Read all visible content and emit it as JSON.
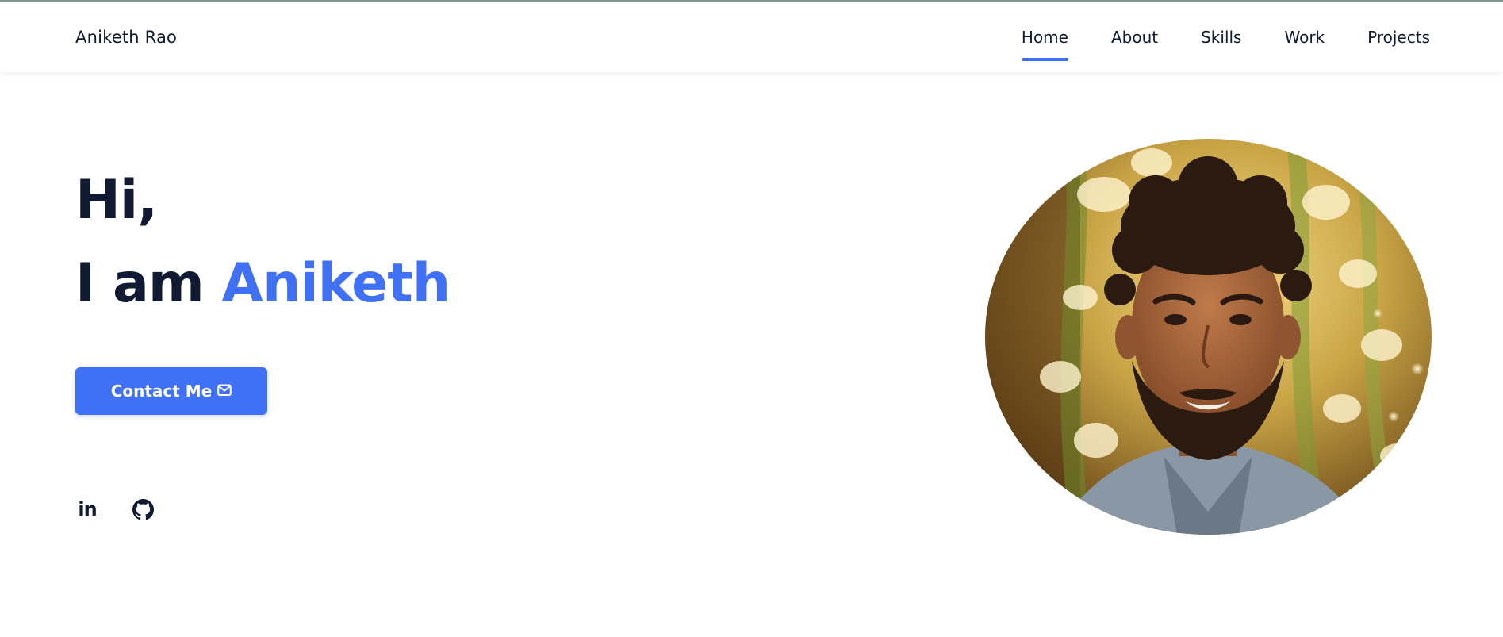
{
  "header": {
    "brand": "Aniketh Rao",
    "nav": [
      {
        "label": "Home",
        "active": true
      },
      {
        "label": "About",
        "active": false
      },
      {
        "label": "Skills",
        "active": false
      },
      {
        "label": "Work",
        "active": false
      },
      {
        "label": "Projects",
        "active": false
      }
    ]
  },
  "hero": {
    "line1": "Hi,",
    "line2_prefix": "I am ",
    "name": "Aniketh",
    "contact_label": "Contact Me",
    "contact_icon": "mail-icon"
  },
  "social": {
    "icons": [
      "linkedin-icon",
      "github-icon"
    ],
    "linkedin_text": "in"
  },
  "photo": {
    "subject": "profile-portrait"
  },
  "colors": {
    "accent": "#4070f4",
    "text": "#111a33",
    "background": "#ffffff"
  }
}
